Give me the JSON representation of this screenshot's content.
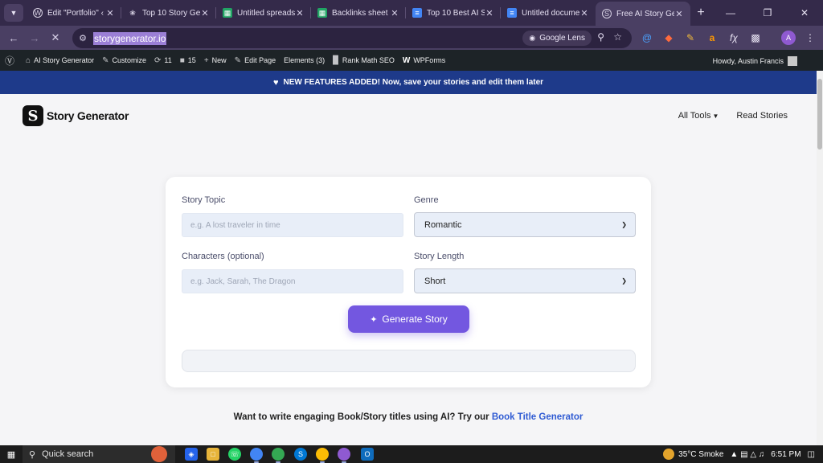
{
  "browser": {
    "tabs": [
      {
        "title": "Edit \"Portfolio\" ‹",
        "favicon": "wordpress-icon",
        "color": "#d6d0e2"
      },
      {
        "title": "Top 10 Story Ge",
        "favicon": "openai-icon",
        "color": "#d6d0e2"
      },
      {
        "title": "Untitled spreads",
        "favicon": "sheets-icon",
        "color": "#21a464"
      },
      {
        "title": "Backlinks sheet",
        "favicon": "sheets-icon",
        "color": "#21a464"
      },
      {
        "title": "Top 10 Best AI S",
        "favicon": "docs-icon",
        "color": "#4285f4"
      },
      {
        "title": "Untitled docume",
        "favicon": "docs-icon",
        "color": "#4285f4"
      },
      {
        "title": "Free AI Story Ge",
        "favicon": "story-generator-icon",
        "color": "#d6d0e2",
        "active": true
      }
    ],
    "url": "storygenerator.io",
    "lens_label": "Google Lens"
  },
  "wp_admin_bar": {
    "site_name": "AI Story Generator",
    "customize": "Customize",
    "updates": "11",
    "comments": "15",
    "new": "New",
    "edit_page": "Edit Page",
    "elements": "Elements (3)",
    "rank_math": "Rank Math SEO",
    "wpforms": "WPForms",
    "howdy": "Howdy, Austin Francis"
  },
  "announcement": "NEW FEATURES ADDED! Now, save your stories and edit them later",
  "site": {
    "brand": "Story Generator",
    "brand_mark": "S",
    "nav": {
      "all_tools": "All Tools",
      "read_stories": "Read Stories"
    },
    "form": {
      "topic_label": "Story Topic",
      "topic_placeholder": "e.g. A lost traveler in time",
      "genre_label": "Genre",
      "genre_value": "Romantic",
      "characters_label": "Characters (optional)",
      "characters_placeholder": "e.g. Jack, Sarah, The Dragon",
      "length_label": "Story Length",
      "length_value": "Short",
      "generate_label": "Generate Story"
    },
    "promo_text": "Want to write engaging Book/Story titles using AI? Try our ",
    "promo_link": "Book Title Generator"
  },
  "taskbar": {
    "search_label": "Quick search",
    "weather": "35°C  Smoke",
    "time": "6:51 PM"
  },
  "colors": {
    "accent": "#7357e0",
    "announce_bg": "#1e3a8a",
    "link": "#2f5bd3"
  }
}
